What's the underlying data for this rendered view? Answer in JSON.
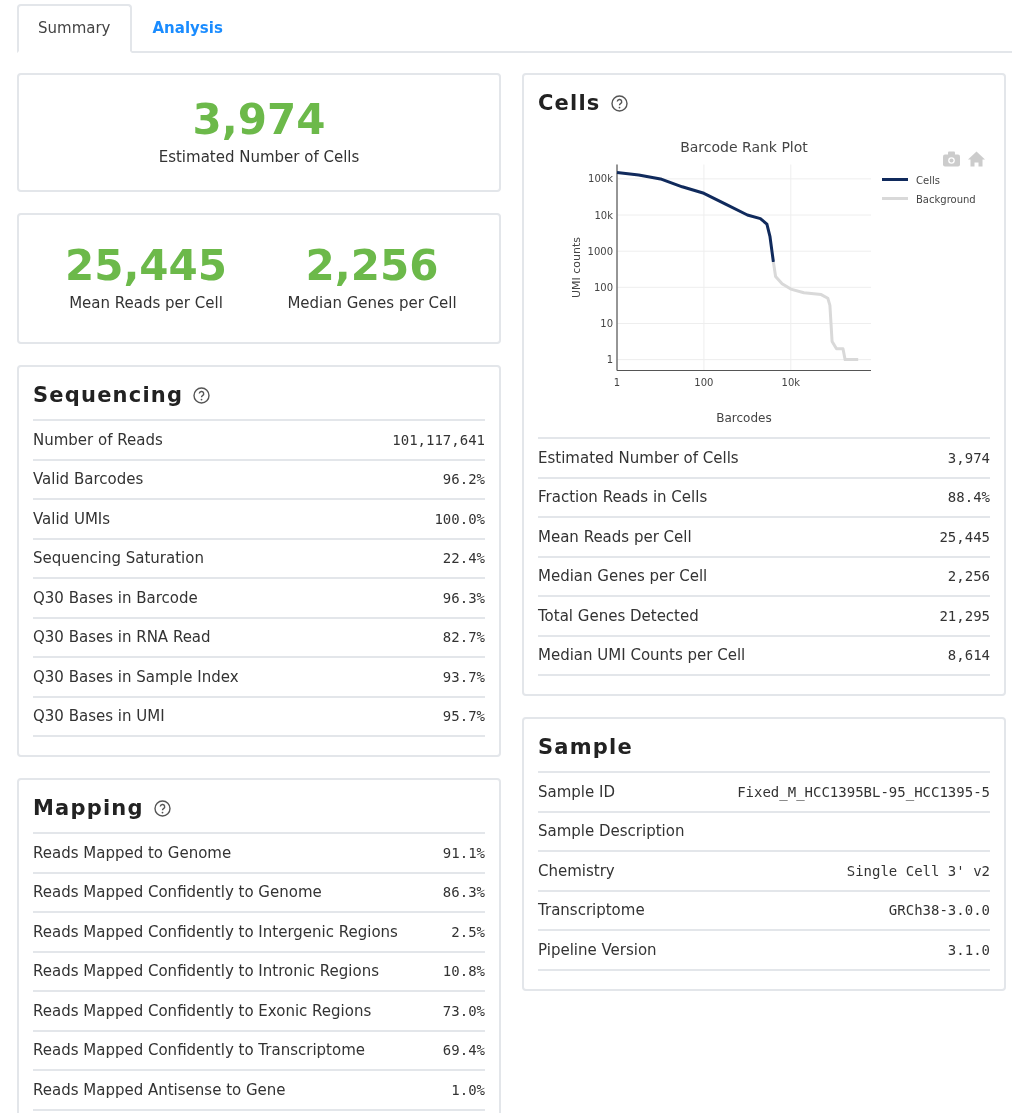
{
  "tabs": [
    {
      "label": "Summary",
      "selected": true
    },
    {
      "label": "Analysis",
      "selected": false
    }
  ],
  "headline": {
    "value": "3,974",
    "label": "Estimated Number of Cells"
  },
  "pair": [
    {
      "value": "25,445",
      "label": "Mean Reads per Cell"
    },
    {
      "value": "2,256",
      "label": "Median Genes per Cell"
    }
  ],
  "left_sections": [
    {
      "title": "Sequencing",
      "help": true,
      "rows": [
        {
          "label": "Number of Reads",
          "value": "101,117,641"
        },
        {
          "label": "Valid Barcodes",
          "value": "96.2%"
        },
        {
          "label": "Valid UMIs",
          "value": "100.0%"
        },
        {
          "label": "Sequencing Saturation",
          "value": "22.4%"
        },
        {
          "label": "Q30 Bases in Barcode",
          "value": "96.3%"
        },
        {
          "label": "Q30 Bases in RNA Read",
          "value": "82.7%"
        },
        {
          "label": "Q30 Bases in Sample Index",
          "value": "93.7%"
        },
        {
          "label": "Q30 Bases in UMI",
          "value": "95.7%"
        }
      ]
    },
    {
      "title": "Mapping",
      "help": true,
      "rows": [
        {
          "label": "Reads Mapped to Genome",
          "value": "91.1%"
        },
        {
          "label": "Reads Mapped Confidently to Genome",
          "value": "86.3%"
        },
        {
          "label": "Reads Mapped Confidently to Intergenic Regions",
          "value": "2.5%"
        },
        {
          "label": "Reads Mapped Confidently to Intronic Regions",
          "value": "10.8%"
        },
        {
          "label": "Reads Mapped Confidently to Exonic Regions",
          "value": "73.0%"
        },
        {
          "label": "Reads Mapped Confidently to Transcriptome",
          "value": "69.4%"
        },
        {
          "label": "Reads Mapped Antisense to Gene",
          "value": "1.0%"
        }
      ]
    }
  ],
  "right_sections": [
    {
      "title": "Cells",
      "help": true,
      "plot": {
        "title": "Barcode Rank Plot",
        "xlabel": "Barcodes",
        "ylabel": "UMI counts",
        "x_tick_labels": [
          "1",
          "100",
          "10k"
        ],
        "y_tick_labels": [
          "100k",
          "10k",
          "1000",
          "100",
          "10",
          "1"
        ],
        "legend": [
          {
            "name": "Cells",
            "color": "#102a5c"
          },
          {
            "name": "Background",
            "color": "#d9d9d9"
          }
        ]
      },
      "rows": [
        {
          "label": "Estimated Number of Cells",
          "value": "3,974"
        },
        {
          "label": "Fraction Reads in Cells",
          "value": "88.4%"
        },
        {
          "label": "Mean Reads per Cell",
          "value": "25,445"
        },
        {
          "label": "Median Genes per Cell",
          "value": "2,256"
        },
        {
          "label": "Total Genes Detected",
          "value": "21,295"
        },
        {
          "label": "Median UMI Counts per Cell",
          "value": "8,614"
        }
      ]
    },
    {
      "title": "Sample",
      "help": false,
      "rows": [
        {
          "label": "Sample ID",
          "value": "Fixed_M_HCC1395BL-95_HCC1395-5"
        },
        {
          "label": "Sample Description"
        },
        {
          "label": "Chemistry",
          "value": "Single Cell 3' v2"
        },
        {
          "label": "Transcriptome",
          "value": "GRCh38-3.0.0"
        },
        {
          "label": "Pipeline Version",
          "value": "3.1.0"
        }
      ]
    }
  ]
}
